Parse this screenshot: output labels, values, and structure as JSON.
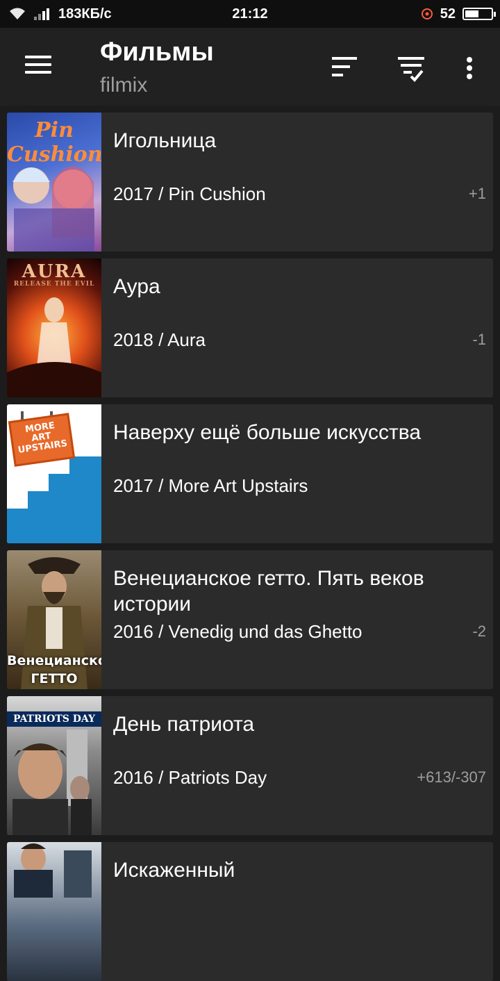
{
  "status": {
    "speed": "183КБ/с",
    "time": "21:12",
    "battery": "52",
    "battery_level": 0.52
  },
  "toolbar": {
    "title": "Фильмы",
    "subtitle": "filmix"
  },
  "icons": {
    "menu": "hamburger-menu-icon",
    "sort": "sort-icon",
    "filter": "filter-check-icon",
    "more": "more-vertical-icon",
    "wifi": "wifi-icon",
    "signal": "signal-icon",
    "alarm": "alarm-icon",
    "battery": "battery-icon"
  },
  "colors": {
    "background": "#1c1c1c",
    "toolbar": "#212121",
    "card": "#2b2b2b",
    "subtitle": "#9e9e9e"
  },
  "movies": [
    {
      "title": "Игольница",
      "subtitle": "2017 / Pin Cushion",
      "rating": "+1",
      "poster_text": "Pin Cushion"
    },
    {
      "title": "Аура",
      "subtitle": "2018 / Aura",
      "rating": "-1",
      "poster_text": "AURA",
      "poster_tagline": "RELEASE THE EVIL"
    },
    {
      "title": "Наверху ещё больше искусства",
      "subtitle": "2017 / More Art Upstairs",
      "rating": "",
      "poster_text": "MORE ART UPSTAIRS"
    },
    {
      "title": "Венецианское гетто. Пять веков истории",
      "subtitle": "2016 / Venedig und das Ghetto",
      "rating": "-2",
      "poster_text": "Венецианское ГЕТТО"
    },
    {
      "title": "День патриота",
      "subtitle": "2016 / Patriots Day",
      "rating": "+613/-307",
      "poster_text": "PATRIOTS DAY"
    },
    {
      "title": "Искаженный",
      "subtitle": "",
      "rating": ""
    }
  ]
}
